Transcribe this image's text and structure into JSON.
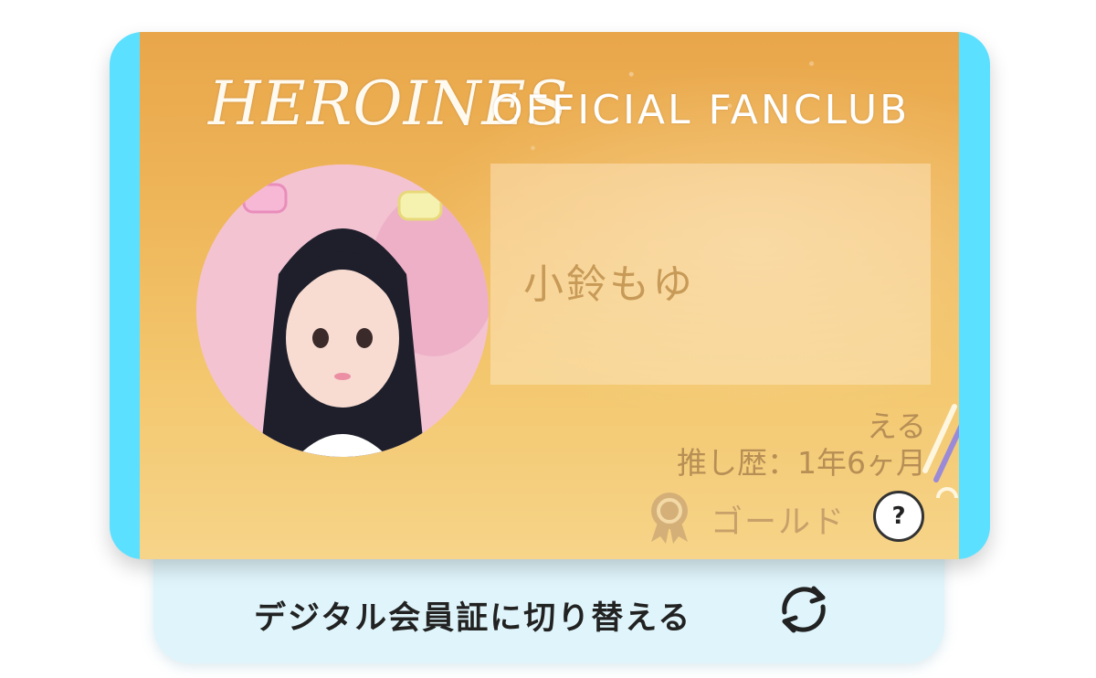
{
  "card": {
    "logo": "HEROINES",
    "subtitle": "OFFICIAL FANCLUB",
    "member_name": "小鈴もゆ",
    "nickname": "える",
    "oshi_history": "推し歴：1年6ヶ月",
    "rank": "ゴールド",
    "help_label": "?",
    "colors": {
      "frame": "#5ce0ff",
      "card_top": "#e9a64a",
      "card_bottom": "#f6d489",
      "text": "#b78e55"
    }
  },
  "switch": {
    "label": "デジタル会員証に切り替える",
    "icon": "refresh-icon"
  },
  "icons": {
    "rank": "medal-icon",
    "help": "question-icon"
  }
}
